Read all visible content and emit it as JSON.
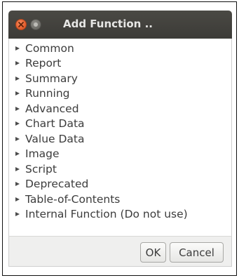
{
  "window": {
    "title": "Add Function .."
  },
  "tree": {
    "items": [
      {
        "label": "Common"
      },
      {
        "label": "Report"
      },
      {
        "label": "Summary"
      },
      {
        "label": "Running"
      },
      {
        "label": "Advanced"
      },
      {
        "label": "Chart Data"
      },
      {
        "label": "Value Data"
      },
      {
        "label": "Image"
      },
      {
        "label": "Script"
      },
      {
        "label": "Deprecated"
      },
      {
        "label": "Table-of-Contents"
      },
      {
        "label": "Internal Function (Do not use)"
      }
    ]
  },
  "buttons": {
    "ok_label": "OK",
    "cancel_label": "Cancel"
  },
  "colors": {
    "titlebar": "#3c3b37",
    "close_button": "#e05a2a",
    "button_bar": "#efefee"
  },
  "icons": {
    "close": "close-icon",
    "minimize": "minimize-icon",
    "expander": "expander-arrow-icon"
  }
}
